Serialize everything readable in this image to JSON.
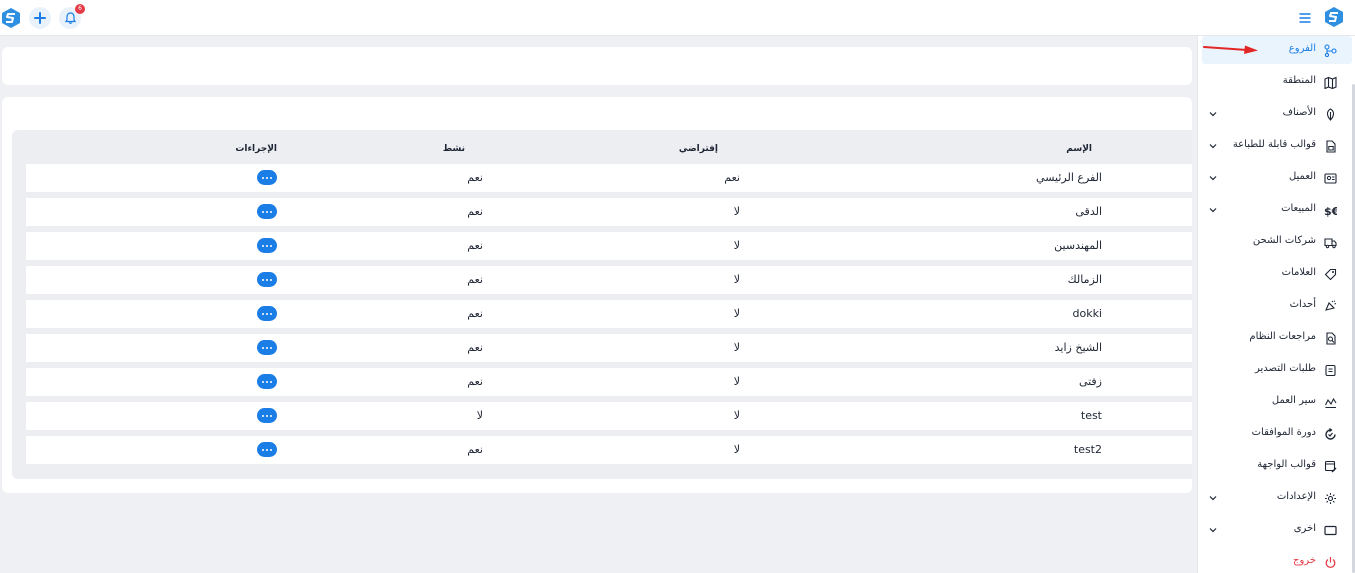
{
  "header": {
    "notification_count": "6"
  },
  "table": {
    "columns": {
      "name": "الإسم",
      "default": "إفتراضي",
      "active": "نشط",
      "actions": "الإجراءات"
    },
    "rows": [
      {
        "name": "الفرع الرئيسي",
        "default": "نعم",
        "active": "نعم"
      },
      {
        "name": "الدقى",
        "default": "لا",
        "active": "نعم"
      },
      {
        "name": "المهندسين",
        "default": "لا",
        "active": "نعم"
      },
      {
        "name": "الزمالك",
        "default": "لا",
        "active": "نعم"
      },
      {
        "name": "dokki",
        "default": "لا",
        "active": "نعم"
      },
      {
        "name": "الشيخ زايد",
        "default": "لا",
        "active": "نعم"
      },
      {
        "name": "زفتى",
        "default": "لا",
        "active": "نعم"
      },
      {
        "name": "test",
        "default": "لا",
        "active": "لا"
      },
      {
        "name": "test2",
        "default": "لا",
        "active": "نعم"
      }
    ]
  },
  "sidebar": {
    "items": [
      {
        "label": "الفروع",
        "icon": "branch-icon",
        "active": true,
        "expandable": false
      },
      {
        "label": "المنطقة",
        "icon": "map-icon",
        "active": false,
        "expandable": false
      },
      {
        "label": "الأصناف",
        "icon": "leaf-icon",
        "active": false,
        "expandable": true
      },
      {
        "label": "قوالب قابلة للطباعة",
        "icon": "print-template-icon",
        "active": false,
        "expandable": true
      },
      {
        "label": "العميل",
        "icon": "customer-icon",
        "active": false,
        "expandable": true
      },
      {
        "label": "المبيعات",
        "icon": "currency-icon",
        "active": false,
        "expandable": true
      },
      {
        "label": "شركات الشحن",
        "icon": "truck-icon",
        "active": false,
        "expandable": false
      },
      {
        "label": "العلامات",
        "icon": "tag-icon",
        "active": false,
        "expandable": false
      },
      {
        "label": "أحداث",
        "icon": "event-icon",
        "active": false,
        "expandable": false
      },
      {
        "label": "مراجعات النظام",
        "icon": "audit-icon",
        "active": false,
        "expandable": false
      },
      {
        "label": "طلبات التصدير",
        "icon": "export-icon",
        "active": false,
        "expandable": false
      },
      {
        "label": "سير العمل",
        "icon": "workflow-icon",
        "active": false,
        "expandable": false
      },
      {
        "label": "دورة الموافقات",
        "icon": "approval-cycle-icon",
        "active": false,
        "expandable": false
      },
      {
        "label": "قوالب الواجهة",
        "icon": "ui-template-icon",
        "active": false,
        "expandable": false
      },
      {
        "label": "الإعدادات",
        "icon": "gear-icon",
        "active": false,
        "expandable": true
      },
      {
        "label": "اخرى",
        "icon": "window-icon",
        "active": false,
        "expandable": true
      },
      {
        "label": "خروج",
        "icon": "power-icon",
        "active": false,
        "expandable": false
      }
    ]
  },
  "colors": {
    "accent": "#1a7ee6",
    "danger": "#e53945",
    "active_bg": "#eaf4fd"
  }
}
